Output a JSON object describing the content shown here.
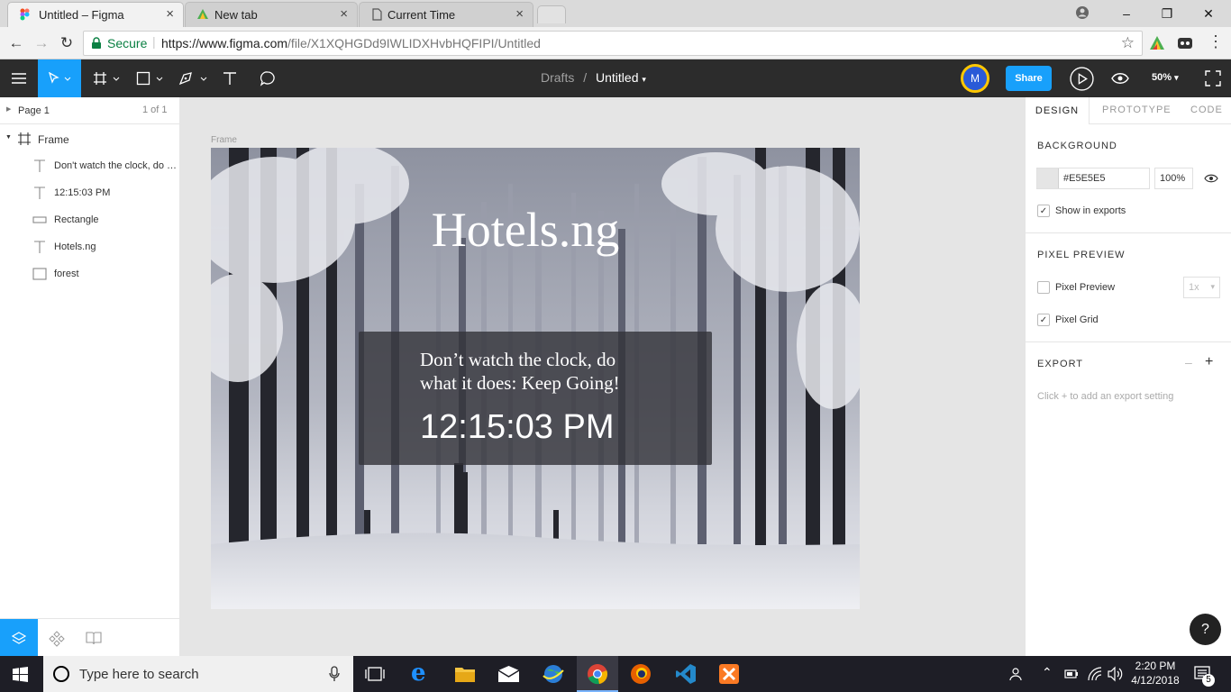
{
  "browser": {
    "tabs": [
      {
        "label": "Untitled – Figma",
        "close": "×"
      },
      {
        "label": "New tab",
        "close": "×"
      },
      {
        "label": "Current Time",
        "close": "×"
      }
    ],
    "window_controls": {
      "minimize": "–",
      "restore": "❐",
      "close": "✕"
    },
    "secure_label": "Secure",
    "url_prefix": "https://www.figma.com",
    "url_path": "/file/X1XQHGDd9IWLIDXHvbHQFIPI/Untitled"
  },
  "figma": {
    "breadcrumb_parent": "Drafts",
    "breadcrumb_sep": "/",
    "file_name": "Untitled",
    "avatar_initial": "M",
    "share_label": "Share",
    "zoom": "50%",
    "accent_color": "#18a0fb"
  },
  "left_panel": {
    "page_label": "Page 1",
    "page_count": "1 of 1",
    "frame_label": "Frame",
    "layers": [
      {
        "name": "Don't watch the clock, do what it does: Keep Going!",
        "icon": "text-icon"
      },
      {
        "name": "12:15:03 PM",
        "icon": "text-icon"
      },
      {
        "name": "Rectangle",
        "icon": "rectangle-icon"
      },
      {
        "name": "Hotels.ng",
        "icon": "text-icon"
      },
      {
        "name": "forest",
        "icon": "image-icon"
      }
    ]
  },
  "canvas": {
    "frame_caption": "Frame",
    "title": "Hotels.ng",
    "quote_line1": "Don’t  watch the clock, do",
    "quote_line2": "what it does: Keep Going!",
    "time": "12:15:03 PM"
  },
  "right_panel": {
    "tabs": [
      "DESIGN",
      "PROTOTYPE",
      "CODE"
    ],
    "background_title": "BACKGROUND",
    "bg_hex": "#E5E5E5",
    "bg_opacity": "100%",
    "show_in_exports": "Show in exports",
    "pixel_preview_title": "PIXEL PREVIEW",
    "pixel_preview_label": "Pixel Preview",
    "pixel_scale": "1x",
    "pixel_grid_label": "Pixel Grid",
    "export_title": "EXPORT",
    "export_hint": "Click + to add an export setting",
    "help": "?"
  },
  "taskbar": {
    "search_placeholder": "Type here to search",
    "time": "2:20 PM",
    "date": "4/12/2018",
    "notif_count": "5"
  }
}
